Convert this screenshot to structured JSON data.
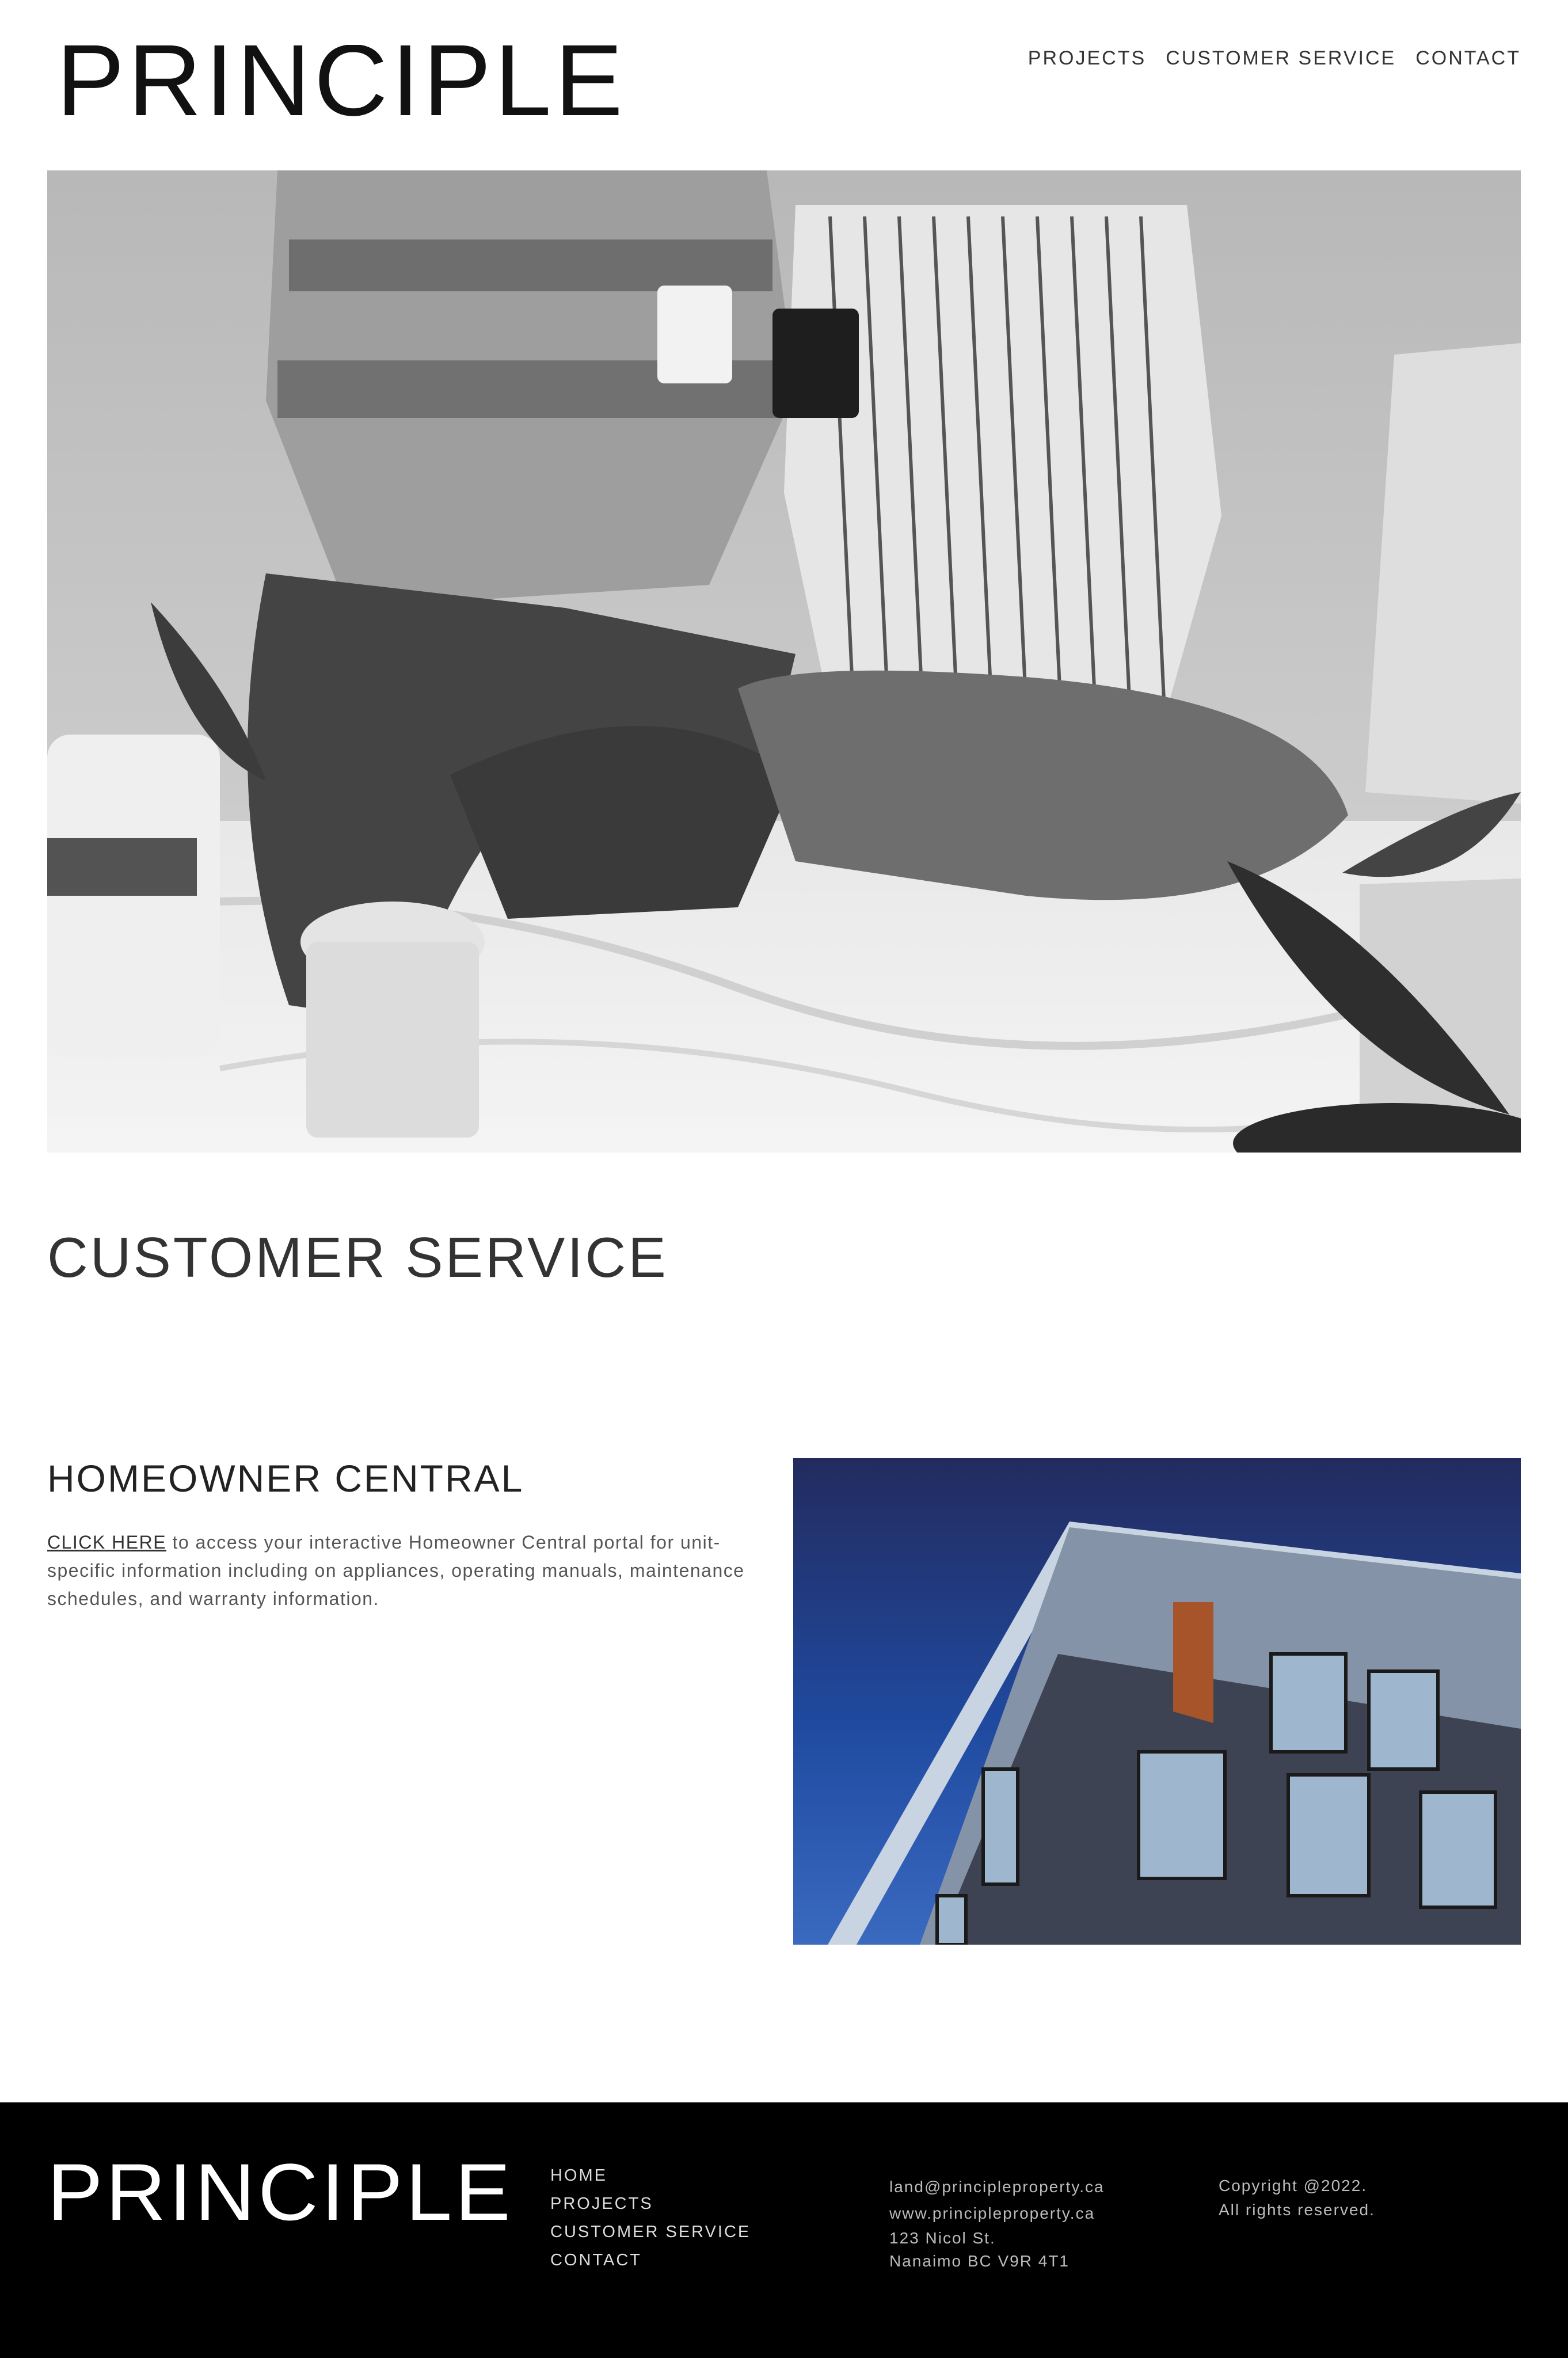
{
  "brand": {
    "logo_text": "PRINCIPLE"
  },
  "nav": {
    "items": [
      {
        "label": "PROJECTS"
      },
      {
        "label": "CUSTOMER SERVICE"
      },
      {
        "label": "CONTACT"
      }
    ]
  },
  "page": {
    "title": "CUSTOMER SERVICE"
  },
  "homeowner": {
    "title": "HOMEOWNER CENTRAL",
    "link_text": "CLICK HERE",
    "body_text": " to access your interactive Homeowner Central portal for unit-specific information including on appliances, operating manuals, maintenance schedules, and warranty information."
  },
  "footer": {
    "nav": [
      {
        "label": "HOME"
      },
      {
        "label": "PROJECTS"
      },
      {
        "label": "CUSTOMER SERVICE"
      },
      {
        "label": "CONTACT"
      }
    ],
    "email": "land@principleproperty.ca",
    "website": "www.principleproperty.ca",
    "address_line1": "123 Nicol St.",
    "address_line2": "Nanaimo BC V9R 4T1",
    "copyright_line1": "Copyright @2022.",
    "copyright_line2": "All rights reserved."
  },
  "colors": {
    "text": "#333333",
    "footer_bg": "#000000",
    "sky_blue": "#1f4aa0"
  }
}
